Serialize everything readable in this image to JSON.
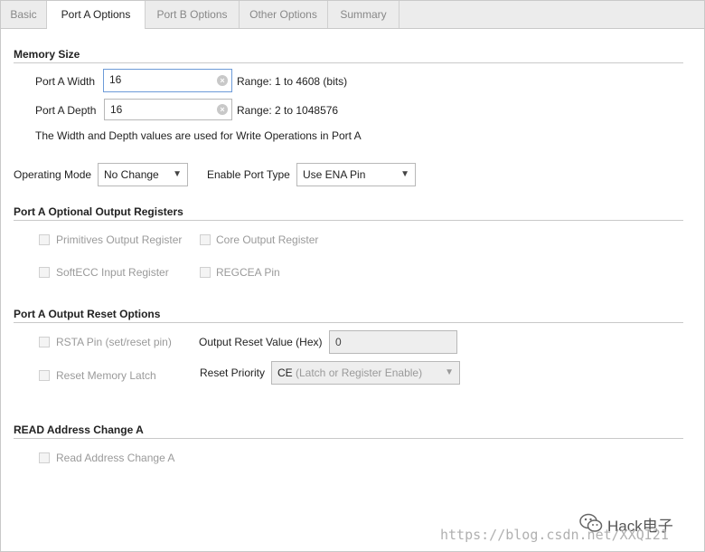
{
  "tabs": [
    {
      "label": "Basic",
      "active": false
    },
    {
      "label": "Port A Options",
      "active": true
    },
    {
      "label": "Port B Options",
      "active": false
    },
    {
      "label": "Other Options",
      "active": false
    },
    {
      "label": "Summary",
      "active": false
    }
  ],
  "memory_size": {
    "title": "Memory Size",
    "width_label": "Port A Width",
    "width_value": "16",
    "width_range": "Range: 1 to 4608 (bits)",
    "depth_label": "Port A Depth",
    "depth_value": "16",
    "depth_range": "Range: 2 to 1048576",
    "note": "The Width and Depth values are used for Write Operations in Port A"
  },
  "operating_mode": {
    "label": "Operating Mode",
    "value": "No Change",
    "enable_label": "Enable Port Type",
    "enable_value": "Use ENA Pin"
  },
  "output_registers": {
    "title": "Port A Optional Output Registers",
    "primitives": "Primitives Output Register",
    "core": "Core Output Register",
    "softecc": "SoftECC Input Register",
    "regcea": "REGCEA Pin"
  },
  "reset_options": {
    "title": "Port A Output Reset Options",
    "rsta": "RSTA Pin (set/reset pin)",
    "reset_value_label": "Output Reset Value (Hex)",
    "reset_value": "0",
    "reset_latch": "Reset Memory Latch",
    "priority_label": "Reset Priority",
    "priority_value_main": "CE",
    "priority_value_rest": " (Latch or Register Enable)"
  },
  "read_address": {
    "title": "READ Address Change A",
    "checkbox": "Read Address Change A"
  },
  "watermark": {
    "url": "https://blog.csdn.net/XXQI21",
    "brand": "Hack电子"
  },
  "icons": {
    "clear": "clear-icon",
    "dropdown": "chevron-down-icon",
    "wechat": "wechat-icon"
  },
  "colors": {
    "focus_border": "#6d9bd8",
    "disabled_text": "#9a9a9a",
    "tab_bg": "#ececec"
  }
}
